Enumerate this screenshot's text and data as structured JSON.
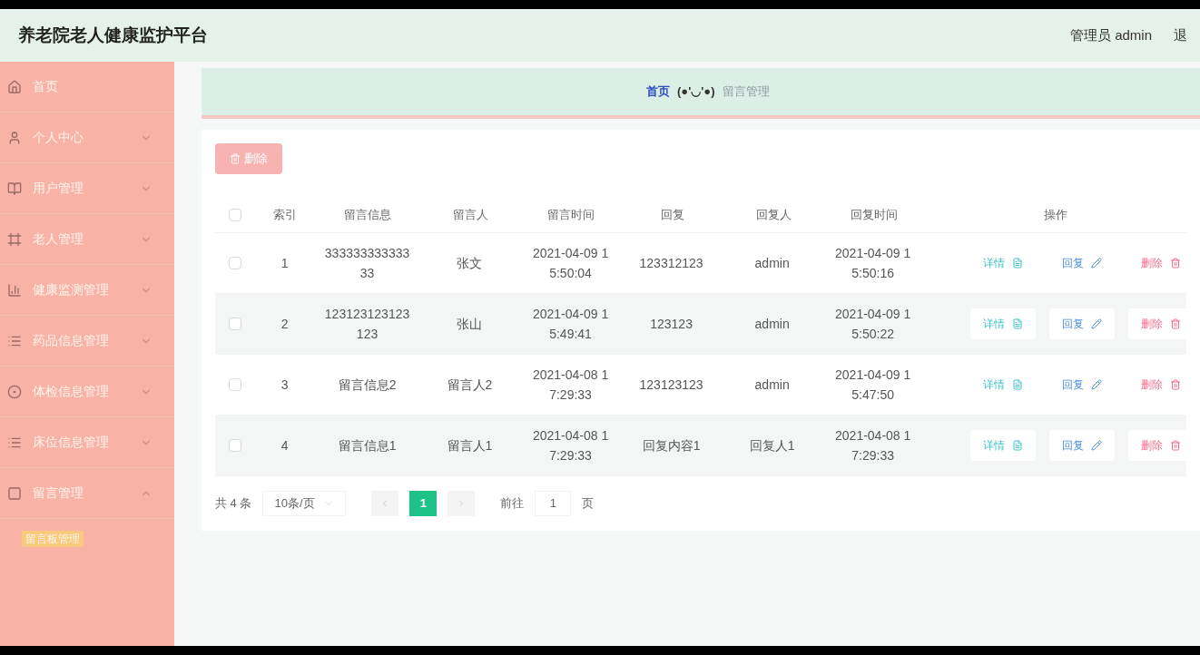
{
  "header": {
    "title": "养老院老人健康监护平台",
    "user": "管理员 admin",
    "logout": "退"
  },
  "sidebar": {
    "items": [
      {
        "label": "首页",
        "kind": "link"
      },
      {
        "label": "个人中心",
        "kind": "menu"
      },
      {
        "label": "用户管理",
        "kind": "menu"
      },
      {
        "label": "老人管理",
        "kind": "menu"
      },
      {
        "label": "健康监测管理",
        "kind": "menu"
      },
      {
        "label": "药品信息管理",
        "kind": "menu"
      },
      {
        "label": "体检信息管理",
        "kind": "menu"
      },
      {
        "label": "床位信息管理",
        "kind": "menu"
      },
      {
        "label": "留言管理",
        "kind": "menu",
        "children": [
          {
            "label": "留言板管理",
            "selected": true
          }
        ]
      }
    ]
  },
  "breadcrumb": [
    {
      "label": "首页",
      "kind": "link"
    },
    {
      "label": "(●'◡'●)",
      "kind": "face"
    },
    {
      "label": "留言管理",
      "kind": "current"
    }
  ],
  "toolbar": {
    "delete_button": "删除"
  },
  "table": {
    "select_all": {
      "checked": false
    },
    "columns": [
      "索引",
      "留言信息",
      "留言人",
      "留言时间",
      "回复",
      "回复人",
      "回复时间",
      "操作"
    ],
    "rows": [
      {
        "checked": false,
        "cells": [
          [
            "1"
          ],
          [
            "333333333333",
            "33"
          ],
          [
            "张文"
          ],
          [
            "2021-04-09 1",
            "5:50:04"
          ],
          [
            "123312123"
          ],
          [
            "admin"
          ],
          [
            "2021-04-09 1",
            "5:50:16"
          ]
        ],
        "actions": [
          "详情",
          "回复",
          "删除"
        ]
      },
      {
        "checked": false,
        "cells": [
          [
            "2"
          ],
          [
            "123123123123",
            "123"
          ],
          [
            "张山"
          ],
          [
            "2021-04-09 1",
            "5:49:41"
          ],
          [
            "123123"
          ],
          [
            "admin"
          ],
          [
            "2021-04-09 1",
            "5:50:22"
          ]
        ],
        "actions": [
          "详情",
          "回复",
          "删除"
        ]
      },
      {
        "checked": false,
        "cells": [
          [
            "3"
          ],
          [
            "留言信息2"
          ],
          [
            "留言人2"
          ],
          [
            "2021-04-08 1",
            "7:29:33"
          ],
          [
            "123123123"
          ],
          [
            "admin"
          ],
          [
            "2021-04-09 1",
            "5:47:50"
          ]
        ],
        "actions": [
          "详情",
          "回复",
          "删除"
        ]
      },
      {
        "checked": false,
        "cells": [
          [
            "4"
          ],
          [
            "留言信息1"
          ],
          [
            "留言人1"
          ],
          [
            "2021-04-08 1",
            "7:29:33"
          ],
          [
            "回复内容1"
          ],
          [
            "回复人1"
          ],
          [
            "2021-04-08 1",
            "7:29:33"
          ]
        ],
        "actions": [
          "详情",
          "回复",
          "删除"
        ]
      }
    ]
  },
  "pagination": {
    "total": "共 4 条",
    "page_size": "10条/页",
    "pages": [
      {
        "label": "1",
        "selected": true
      }
    ],
    "goto_label": "前往",
    "goto_value": "1",
    "goto_suffix": "页"
  }
}
